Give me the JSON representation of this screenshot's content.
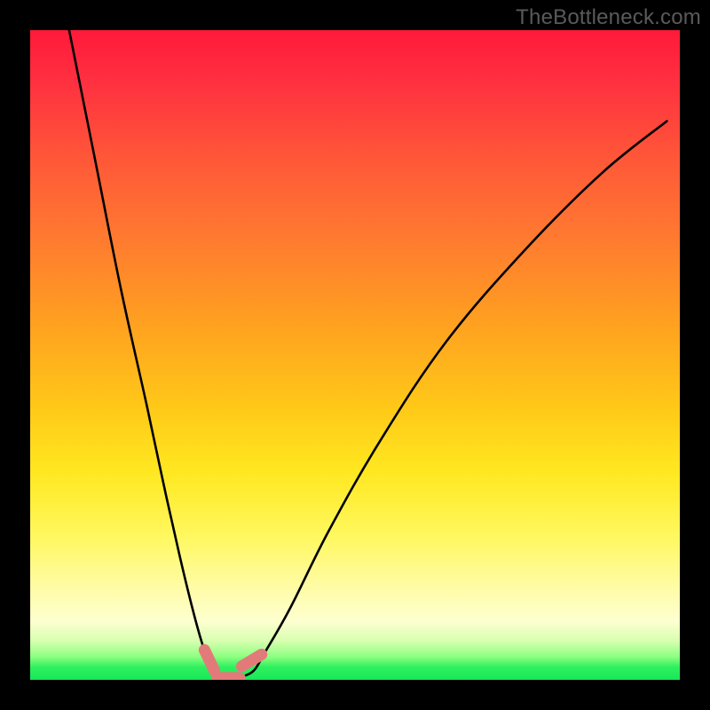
{
  "watermark": "TheBottleneck.com",
  "colors": {
    "frame": "#000000",
    "curve_stroke": "#000000",
    "marker_fill": "#e37a7a",
    "gradient_stops": [
      {
        "stop": 0.0,
        "color": "#ff1a3a"
      },
      {
        "stop": 0.08,
        "color": "#ff3040"
      },
      {
        "stop": 0.2,
        "color": "#ff5838"
      },
      {
        "stop": 0.32,
        "color": "#ff7a30"
      },
      {
        "stop": 0.45,
        "color": "#ffa020"
      },
      {
        "stop": 0.58,
        "color": "#ffc818"
      },
      {
        "stop": 0.68,
        "color": "#ffe820"
      },
      {
        "stop": 0.78,
        "color": "#fff860"
      },
      {
        "stop": 0.86,
        "color": "#fffca8"
      },
      {
        "stop": 0.91,
        "color": "#fdffd0"
      },
      {
        "stop": 0.94,
        "color": "#d8ffb0"
      },
      {
        "stop": 0.965,
        "color": "#8cff80"
      },
      {
        "stop": 0.98,
        "color": "#30f060"
      },
      {
        "stop": 1.0,
        "color": "#18e858"
      }
    ]
  },
  "chart_data": {
    "type": "line",
    "title": "",
    "xlabel": "",
    "ylabel": "",
    "xlim": [
      0,
      100
    ],
    "ylim": [
      0,
      100
    ],
    "series": [
      {
        "name": "bottleneck-curve",
        "x": [
          6,
          10,
          14,
          18,
          21,
          23.5,
          25.5,
          27,
          28.2,
          29,
          30,
          32,
          33,
          34.5,
          36,
          40,
          46,
          54,
          64,
          76,
          88,
          98
        ],
        "values": [
          100,
          80,
          60,
          42,
          28,
          17,
          9,
          4,
          1.5,
          0.6,
          0.3,
          0.3,
          0.6,
          1.5,
          4,
          11,
          23,
          37,
          52,
          66,
          78,
          86
        ]
      }
    ],
    "markers": [
      {
        "name": "left-segment-marker",
        "x": 27.6,
        "y": 3.0
      },
      {
        "name": "right-segment-marker",
        "x": 34.1,
        "y": 3.0
      },
      {
        "name": "bottom-segment-marker",
        "x": 30.5,
        "y": 0.3
      }
    ]
  }
}
